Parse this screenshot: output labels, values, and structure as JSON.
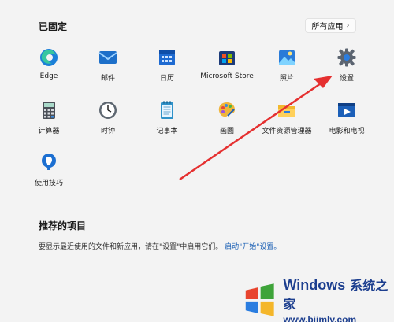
{
  "pinned": {
    "title": "已固定",
    "all_apps_label": "所有应用",
    "apps": [
      {
        "label": "Edge",
        "icon": "edge-icon"
      },
      {
        "label": "邮件",
        "icon": "mail-icon"
      },
      {
        "label": "日历",
        "icon": "calendar-icon"
      },
      {
        "label": "Microsoft Store",
        "icon": "store-icon"
      },
      {
        "label": "照片",
        "icon": "photos-icon"
      },
      {
        "label": "设置",
        "icon": "settings-gear-icon"
      },
      {
        "label": "计算器",
        "icon": "calculator-icon"
      },
      {
        "label": "时钟",
        "icon": "clock-icon"
      },
      {
        "label": "记事本",
        "icon": "notepad-icon"
      },
      {
        "label": "画图",
        "icon": "paint-icon"
      },
      {
        "label": "文件资源管理器",
        "icon": "folder-icon"
      },
      {
        "label": "电影和电视",
        "icon": "movies-tv-icon"
      },
      {
        "label": "使用技巧",
        "icon": "tips-lightbulb-icon"
      }
    ]
  },
  "recommended": {
    "title": "推荐的项目",
    "text_before": "要显示最近使用的文件和新应用，请在\"设置\"中启用它们。",
    "link_text": "启动\"开始\"设置。"
  },
  "watermark": {
    "brand": "Windows",
    "cn": "系统之家",
    "url": "www.bjjmlv.com"
  },
  "colors": {
    "background": "#f3f3f3",
    "arrow": "#e53030",
    "link": "#1a5fb4"
  }
}
